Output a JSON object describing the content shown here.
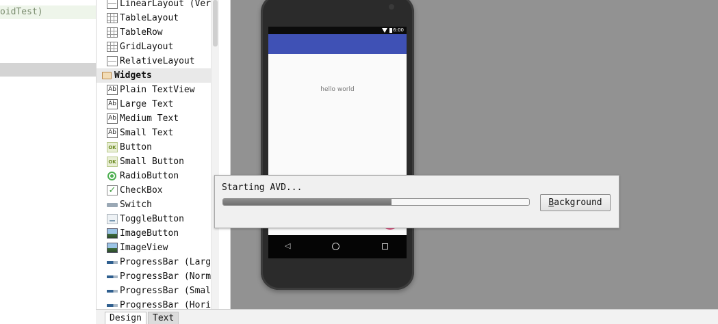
{
  "project_tree": {
    "partial_item": "oidTest)"
  },
  "palette": {
    "items": [
      {
        "label": "LinearLayout (Ver",
        "icon": "layout-icon",
        "group": false
      },
      {
        "label": "TableLayout",
        "icon": "grid-icon",
        "group": false
      },
      {
        "label": "TableRow",
        "icon": "grid-icon",
        "group": false
      },
      {
        "label": "GridLayout",
        "icon": "grid-icon",
        "group": false
      },
      {
        "label": "RelativeLayout",
        "icon": "layout-icon",
        "group": false
      },
      {
        "label": "Widgets",
        "icon": "folder-icon",
        "group": true
      },
      {
        "label": "Plain TextView",
        "icon": "textview-icon",
        "group": false
      },
      {
        "label": "Large Text",
        "icon": "textview-icon",
        "group": false
      },
      {
        "label": "Medium Text",
        "icon": "textview-icon",
        "group": false
      },
      {
        "label": "Small Text",
        "icon": "textview-icon",
        "group": false
      },
      {
        "label": "Button",
        "icon": "button-icon",
        "group": false
      },
      {
        "label": "Small Button",
        "icon": "button-icon",
        "group": false
      },
      {
        "label": "RadioButton",
        "icon": "radio-icon",
        "group": false
      },
      {
        "label": "CheckBox",
        "icon": "checkbox-icon",
        "group": false
      },
      {
        "label": "Switch",
        "icon": "switch-icon",
        "group": false
      },
      {
        "label": "ToggleButton",
        "icon": "toggle-icon",
        "group": false
      },
      {
        "label": "ImageButton",
        "icon": "image-icon",
        "group": false
      },
      {
        "label": "ImageView",
        "icon": "image-icon",
        "group": false
      },
      {
        "label": "ProgressBar (Larg",
        "icon": "progressbar-icon",
        "group": false
      },
      {
        "label": "ProgressBar (Norm",
        "icon": "progressbar-icon",
        "group": false
      },
      {
        "label": "ProgressBar (Smal",
        "icon": "progressbar-icon",
        "group": false
      },
      {
        "label": "ProgressBar (Hori",
        "icon": "progressbar-icon",
        "group": false
      }
    ]
  },
  "device": {
    "status_time": "6:00",
    "hello_text": "hello world",
    "app_bar_color": "#3f51b5",
    "fab_color": "#e24a7c"
  },
  "dialog": {
    "message": "Starting AVD...",
    "progress_fraction": 0.55,
    "background_button_mnemonic": "B",
    "background_button_rest": "ackground"
  },
  "tabs": {
    "design": "Design",
    "text": "Text"
  }
}
